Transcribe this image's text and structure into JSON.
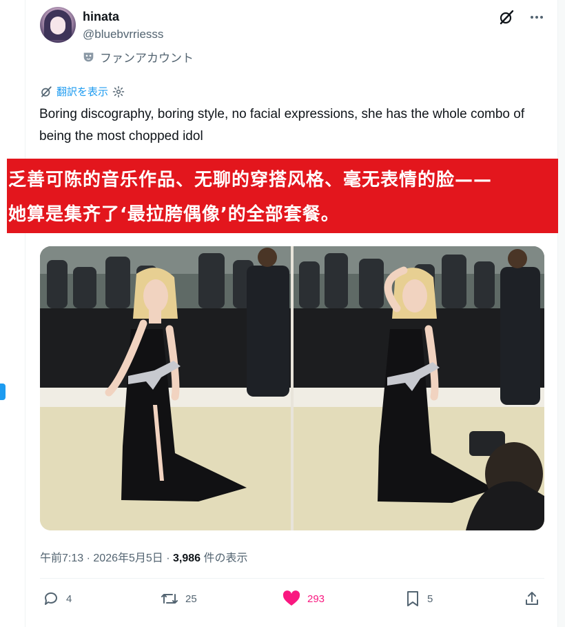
{
  "author": {
    "name": "hinata",
    "handle": "@bluebvrriesss",
    "label": "ファンアカウント"
  },
  "translate": {
    "label": "翻訳を表示"
  },
  "tweet": {
    "text": "Boring discography, boring style, no facial expressions, she has the whole combo of being the most chopped idol"
  },
  "overlay": {
    "line1": "乏善可陈的音乐作品、无聊的穿搭风格、毫无表情的脸——",
    "line2": "她算是集齐了‘最拉胯偶像’的全部套餐。"
  },
  "meta": {
    "time": "午前7:13",
    "separator": "·",
    "date": "2026年5月5日",
    "views_count": "3,986",
    "views_label": "件の表示"
  },
  "actions": {
    "replies": "4",
    "reposts": "25",
    "likes": "293",
    "bookmarks": "5"
  },
  "colors": {
    "accent": "#1d9bf0",
    "like": "#f91880",
    "banner": "#e3161d",
    "muted": "#536471"
  },
  "icons": [
    "grok-icon",
    "more-icon",
    "mask-icon",
    "translate-icon",
    "gear-icon",
    "reply-icon",
    "repost-icon",
    "heart-icon",
    "bookmark-icon",
    "share-icon"
  ]
}
